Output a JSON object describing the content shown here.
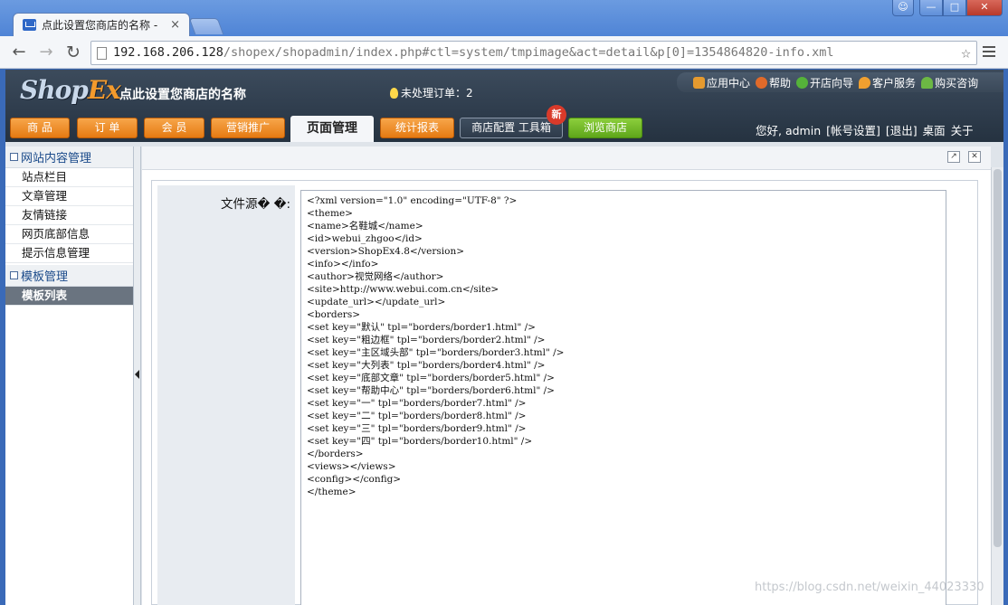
{
  "browser": {
    "tab_title": "点此设置您商店的名称 -",
    "tab_close": "×",
    "url_host": "192.168.206.128",
    "url_path": "/shopex/shopadmin/index.php#ctl=system/tmpimage&act=detail&p[0]=1354864820-info.xml",
    "star": "☆"
  },
  "header": {
    "logo_shop": "Shop",
    "logo_ex": "Ex",
    "shop_name": "点此设置您商店的名称",
    "pending_orders": "未处理订单：2",
    "toplinks": [
      "应用中心",
      "帮助",
      "开店向导",
      "客户服务",
      "购买咨询"
    ]
  },
  "nav": {
    "tabs": [
      "商 品",
      "订 单",
      "会 员",
      "营销推广",
      "页面管理",
      "统计报表",
      "商店配置  工具箱",
      "浏览商店"
    ],
    "new_badge": "新",
    "user": {
      "greeting": "您好, admin",
      "account": "[帐号设置]",
      "logout": "[退出]",
      "desktop": "桌面",
      "about": "关于"
    }
  },
  "sidebar": {
    "groups": [
      {
        "title": "网站内容管理",
        "items": [
          "站点栏目",
          "文章管理",
          "友情链接",
          "网页底部信息",
          "提示信息管理"
        ]
      },
      {
        "title": "模板管理",
        "items": [
          "模板列表"
        ]
      }
    ]
  },
  "main": {
    "field_label": "文件源� �:",
    "code_lines": [
      "<?xml version=\"1.0\" encoding=\"UTF-8\" ?>",
      "<theme>",
      "<name>名鞋城</name>",
      "<id>webui_zhgoo</id>",
      "<version>ShopEx4.8</version>",
      "<info></info>",
      "<author>视觉网络</author>",
      "<site>http://www.webui.com.cn</site>",
      "<update_url></update_url>",
      "<borders>",
      "<set key=\"默认\" tpl=\"borders/border1.html\" />",
      "<set key=\"粗边框\" tpl=\"borders/border2.html\" />",
      "<set key=\"主区域头部\" tpl=\"borders/border3.html\" />",
      "<set key=\"大列表\" tpl=\"borders/border4.html\" />",
      "<set key=\"底部文章\" tpl=\"borders/border5.html\" />",
      "<set key=\"帮助中心\" tpl=\"borders/border6.html\" />",
      "<set key=\"一\" tpl=\"borders/border7.html\" />",
      "<set key=\"二\" tpl=\"borders/border8.html\" />",
      "<set key=\"三\" tpl=\"borders/border9.html\" />",
      "<set key=\"四\" tpl=\"borders/border10.html\" />",
      "</borders>",
      "<views></views>",
      "<config></config>",
      "</theme>"
    ]
  },
  "watermark": "https://blog.csdn.net/weixin_44023330"
}
